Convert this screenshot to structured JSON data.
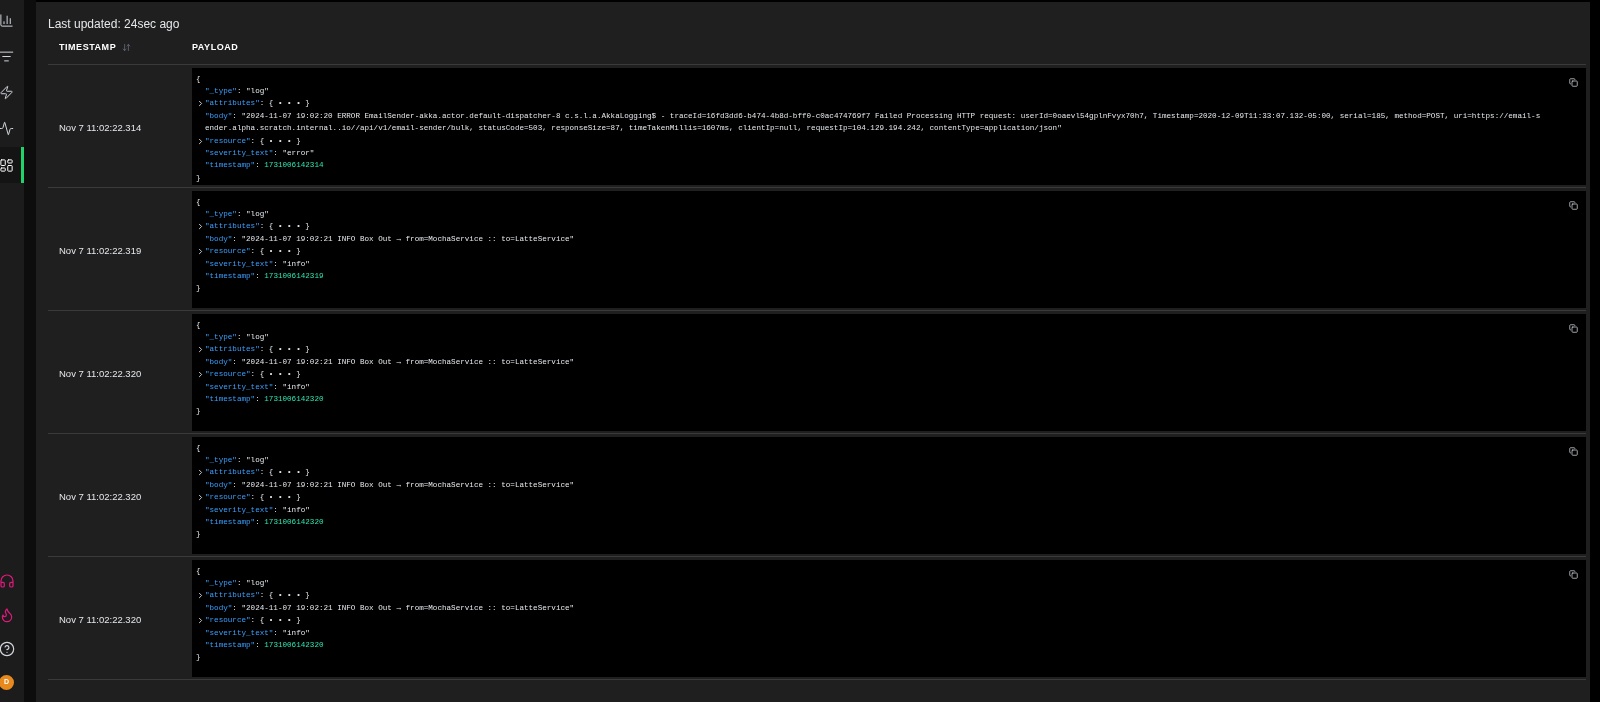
{
  "sidebar": {
    "nav": [
      {
        "kind": "chart",
        "selected": false
      },
      {
        "kind": "filter",
        "selected": false
      },
      {
        "kind": "zap",
        "selected": false
      },
      {
        "kind": "activity",
        "selected": false
      },
      {
        "kind": "dashboard",
        "selected": true
      }
    ],
    "footer": [
      {
        "kind": "headset"
      },
      {
        "kind": "flame"
      },
      {
        "kind": "help"
      }
    ],
    "avatar": "D"
  },
  "last_updated": "Last updated: 24sec ago",
  "columns": [
    {
      "label": "TIMESTAMP",
      "sortable": true
    },
    {
      "label": "PAYLOAD",
      "sortable": false
    }
  ],
  "rows": [
    {
      "timestamp": "Nov 7 11:02:22.314",
      "open": "{",
      "close": "}",
      "fields": [
        {
          "key": "\"_type\"",
          "colon": ":",
          "value": "\"log\"",
          "kind": "string"
        },
        {
          "key": "\"attributes\"",
          "colon": ":",
          "value": "{ • • • }",
          "kind": "collapsed",
          "expanded": false
        },
        {
          "key": "\"body\"",
          "colon": ":",
          "value": "\"2024-11-07 19:02:20 ERROR EmailSender-akka.actor.default-dispatcher-8 c.s.l.a.AkkaLogging$ - traceId=16fd3dd6-b474-4b8d-bff0-c0ac474769f7 Failed Processing HTTP request: userId=0oaevl54gplnFvyx70h7, Timestamp=2020-12-09T11:33:07.132-05:00, serial=185, method=POST, uri=https://email-sender.alpha.scratch.internal..io//api/v1/email-sender/bulk, statusCode=503, responseSize=87, timeTakenMillis=1607ms, clientIp=null, requestIp=104.129.194.242, contentType=application/json\"",
          "kind": "string"
        },
        {
          "key": "\"resource\"",
          "colon": ":",
          "value": "{ • • • }",
          "kind": "collapsed",
          "expanded": false
        },
        {
          "key": "\"severity_text\"",
          "colon": ":",
          "value": "\"error\"",
          "kind": "string"
        },
        {
          "key": "\"timestamp\"",
          "colon": ":",
          "value": "1731006142314",
          "kind": "number"
        }
      ]
    },
    {
      "timestamp": "Nov 7 11:02:22.319",
      "open": "{",
      "close": "}",
      "fields": [
        {
          "key": "\"_type\"",
          "colon": ":",
          "value": "\"log\"",
          "kind": "string"
        },
        {
          "key": "\"attributes\"",
          "colon": ":",
          "value": "{ • • • }",
          "kind": "collapsed",
          "expanded": false
        },
        {
          "key": "\"body\"",
          "colon": ":",
          "value": "\"2024-11-07 19:02:21 INFO Box Out → from=MochaService :: to=LatteService\"",
          "kind": "string"
        },
        {
          "key": "\"resource\"",
          "colon": ":",
          "value": "{ • • • }",
          "kind": "collapsed",
          "expanded": false
        },
        {
          "key": "\"severity_text\"",
          "colon": ":",
          "value": "\"info\"",
          "kind": "string"
        },
        {
          "key": "\"timestamp\"",
          "colon": ":",
          "value": "1731006142319",
          "kind": "number"
        }
      ]
    },
    {
      "timestamp": "Nov 7 11:02:22.320",
      "open": "{",
      "close": "}",
      "fields": [
        {
          "key": "\"_type\"",
          "colon": ":",
          "value": "\"log\"",
          "kind": "string"
        },
        {
          "key": "\"attributes\"",
          "colon": ":",
          "value": "{ • • • }",
          "kind": "collapsed",
          "expanded": false
        },
        {
          "key": "\"body\"",
          "colon": ":",
          "value": "\"2024-11-07 19:02:21 INFO Box Out → from=MochaService :: to=LatteService\"",
          "kind": "string"
        },
        {
          "key": "\"resource\"",
          "colon": ":",
          "value": "{ • • • }",
          "kind": "collapsed",
          "expanded": false
        },
        {
          "key": "\"severity_text\"",
          "colon": ":",
          "value": "\"info\"",
          "kind": "string"
        },
        {
          "key": "\"timestamp\"",
          "colon": ":",
          "value": "1731006142320",
          "kind": "number"
        }
      ]
    },
    {
      "timestamp": "Nov 7 11:02:22.320",
      "open": "{",
      "close": "}",
      "fields": [
        {
          "key": "\"_type\"",
          "colon": ":",
          "value": "\"log\"",
          "kind": "string"
        },
        {
          "key": "\"attributes\"",
          "colon": ":",
          "value": "{ • • • }",
          "kind": "collapsed",
          "expanded": false
        },
        {
          "key": "\"body\"",
          "colon": ":",
          "value": "\"2024-11-07 19:02:21 INFO Box Out → from=MochaService :: to=LatteService\"",
          "kind": "string"
        },
        {
          "key": "\"resource\"",
          "colon": ":",
          "value": "{ • • • }",
          "kind": "collapsed",
          "expanded": false
        },
        {
          "key": "\"severity_text\"",
          "colon": ":",
          "value": "\"info\"",
          "kind": "string"
        },
        {
          "key": "\"timestamp\"",
          "colon": ":",
          "value": "1731006142320",
          "kind": "number"
        }
      ]
    },
    {
      "timestamp": "Nov 7 11:02:22.320",
      "open": "{",
      "close": "}",
      "fields": [
        {
          "key": "\"_type\"",
          "colon": ":",
          "value": "\"log\"",
          "kind": "string"
        },
        {
          "key": "\"attributes\"",
          "colon": ":",
          "value": "{ • • • }",
          "kind": "collapsed",
          "expanded": false
        },
        {
          "key": "\"body\"",
          "colon": ":",
          "value": "\"2024-11-07 19:02:21 INFO Box Out → from=MochaService :: to=LatteService\"",
          "kind": "string"
        },
        {
          "key": "\"resource\"",
          "colon": ":",
          "value": "{ • • • }",
          "kind": "collapsed",
          "expanded": false
        },
        {
          "key": "\"severity_text\"",
          "colon": ":",
          "value": "\"info\"",
          "kind": "string"
        },
        {
          "key": "\"timestamp\"",
          "colon": ":",
          "value": "1731006142320",
          "kind": "number"
        }
      ]
    }
  ]
}
